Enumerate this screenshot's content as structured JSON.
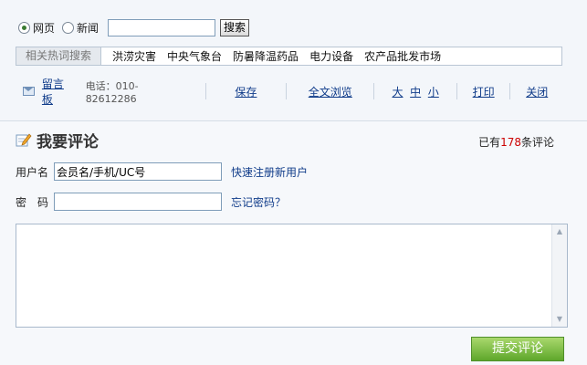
{
  "search": {
    "radio_web": "网页",
    "radio_news": "新闻",
    "input_value": "",
    "button": "搜索"
  },
  "hot": {
    "label": "相关热词搜索",
    "items": [
      "洪涝灾害",
      "中央气象台",
      "防暑降温药品",
      "电力设备",
      "农产品批发市场"
    ]
  },
  "tools": {
    "guestbook": "留言板",
    "phone": "电话：010-82612286",
    "save": "保存",
    "fulltext": "全文浏览",
    "font_large": "大",
    "font_mid": "中",
    "font_small": "小",
    "print": "打印",
    "close": "关闭"
  },
  "comment": {
    "title": "我要评论",
    "count_prefix": "已有",
    "count_value": "178",
    "count_suffix": "条评论",
    "username_label": "用户名",
    "username_value": "会员名/手机/UC号",
    "register_link": "快速注册新用户",
    "password_label": "密　码",
    "forgot_link": "忘记密码？",
    "submit": "提交评论"
  },
  "colors": {
    "link": "#103c8a",
    "count_number": "#cc0000",
    "submit_green": "#5ea72b"
  }
}
